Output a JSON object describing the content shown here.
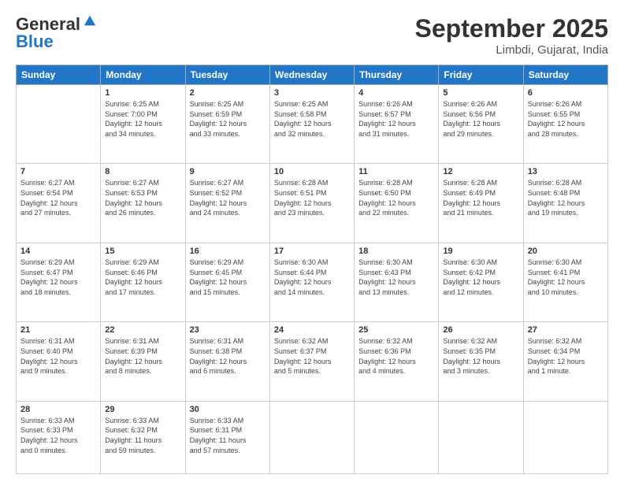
{
  "header": {
    "logo_line1": "General",
    "logo_line2": "Blue",
    "month_title": "September 2025",
    "location": "Limbdi, Gujarat, India"
  },
  "weekdays": [
    "Sunday",
    "Monday",
    "Tuesday",
    "Wednesday",
    "Thursday",
    "Friday",
    "Saturday"
  ],
  "weeks": [
    [
      {
        "day": "",
        "info": ""
      },
      {
        "day": "1",
        "info": "Sunrise: 6:25 AM\nSunset: 7:00 PM\nDaylight: 12 hours\nand 34 minutes."
      },
      {
        "day": "2",
        "info": "Sunrise: 6:25 AM\nSunset: 6:59 PM\nDaylight: 12 hours\nand 33 minutes."
      },
      {
        "day": "3",
        "info": "Sunrise: 6:25 AM\nSunset: 6:58 PM\nDaylight: 12 hours\nand 32 minutes."
      },
      {
        "day": "4",
        "info": "Sunrise: 6:26 AM\nSunset: 6:57 PM\nDaylight: 12 hours\nand 31 minutes."
      },
      {
        "day": "5",
        "info": "Sunrise: 6:26 AM\nSunset: 6:56 PM\nDaylight: 12 hours\nand 29 minutes."
      },
      {
        "day": "6",
        "info": "Sunrise: 6:26 AM\nSunset: 6:55 PM\nDaylight: 12 hours\nand 28 minutes."
      }
    ],
    [
      {
        "day": "7",
        "info": "Sunrise: 6:27 AM\nSunset: 6:54 PM\nDaylight: 12 hours\nand 27 minutes."
      },
      {
        "day": "8",
        "info": "Sunrise: 6:27 AM\nSunset: 6:53 PM\nDaylight: 12 hours\nand 26 minutes."
      },
      {
        "day": "9",
        "info": "Sunrise: 6:27 AM\nSunset: 6:52 PM\nDaylight: 12 hours\nand 24 minutes."
      },
      {
        "day": "10",
        "info": "Sunrise: 6:28 AM\nSunset: 6:51 PM\nDaylight: 12 hours\nand 23 minutes."
      },
      {
        "day": "11",
        "info": "Sunrise: 6:28 AM\nSunset: 6:50 PM\nDaylight: 12 hours\nand 22 minutes."
      },
      {
        "day": "12",
        "info": "Sunrise: 6:28 AM\nSunset: 6:49 PM\nDaylight: 12 hours\nand 21 minutes."
      },
      {
        "day": "13",
        "info": "Sunrise: 6:28 AM\nSunset: 6:48 PM\nDaylight: 12 hours\nand 19 minutes."
      }
    ],
    [
      {
        "day": "14",
        "info": "Sunrise: 6:29 AM\nSunset: 6:47 PM\nDaylight: 12 hours\nand 18 minutes."
      },
      {
        "day": "15",
        "info": "Sunrise: 6:29 AM\nSunset: 6:46 PM\nDaylight: 12 hours\nand 17 minutes."
      },
      {
        "day": "16",
        "info": "Sunrise: 6:29 AM\nSunset: 6:45 PM\nDaylight: 12 hours\nand 15 minutes."
      },
      {
        "day": "17",
        "info": "Sunrise: 6:30 AM\nSunset: 6:44 PM\nDaylight: 12 hours\nand 14 minutes."
      },
      {
        "day": "18",
        "info": "Sunrise: 6:30 AM\nSunset: 6:43 PM\nDaylight: 12 hours\nand 13 minutes."
      },
      {
        "day": "19",
        "info": "Sunrise: 6:30 AM\nSunset: 6:42 PM\nDaylight: 12 hours\nand 12 minutes."
      },
      {
        "day": "20",
        "info": "Sunrise: 6:30 AM\nSunset: 6:41 PM\nDaylight: 12 hours\nand 10 minutes."
      }
    ],
    [
      {
        "day": "21",
        "info": "Sunrise: 6:31 AM\nSunset: 6:40 PM\nDaylight: 12 hours\nand 9 minutes."
      },
      {
        "day": "22",
        "info": "Sunrise: 6:31 AM\nSunset: 6:39 PM\nDaylight: 12 hours\nand 8 minutes."
      },
      {
        "day": "23",
        "info": "Sunrise: 6:31 AM\nSunset: 6:38 PM\nDaylight: 12 hours\nand 6 minutes."
      },
      {
        "day": "24",
        "info": "Sunrise: 6:32 AM\nSunset: 6:37 PM\nDaylight: 12 hours\nand 5 minutes."
      },
      {
        "day": "25",
        "info": "Sunrise: 6:32 AM\nSunset: 6:36 PM\nDaylight: 12 hours\nand 4 minutes."
      },
      {
        "day": "26",
        "info": "Sunrise: 6:32 AM\nSunset: 6:35 PM\nDaylight: 12 hours\nand 3 minutes."
      },
      {
        "day": "27",
        "info": "Sunrise: 6:32 AM\nSunset: 6:34 PM\nDaylight: 12 hours\nand 1 minute."
      }
    ],
    [
      {
        "day": "28",
        "info": "Sunrise: 6:33 AM\nSunset: 6:33 PM\nDaylight: 12 hours\nand 0 minutes."
      },
      {
        "day": "29",
        "info": "Sunrise: 6:33 AM\nSunset: 6:32 PM\nDaylight: 11 hours\nand 59 minutes."
      },
      {
        "day": "30",
        "info": "Sunrise: 6:33 AM\nSunset: 6:31 PM\nDaylight: 11 hours\nand 57 minutes."
      },
      {
        "day": "",
        "info": ""
      },
      {
        "day": "",
        "info": ""
      },
      {
        "day": "",
        "info": ""
      },
      {
        "day": "",
        "info": ""
      }
    ]
  ]
}
